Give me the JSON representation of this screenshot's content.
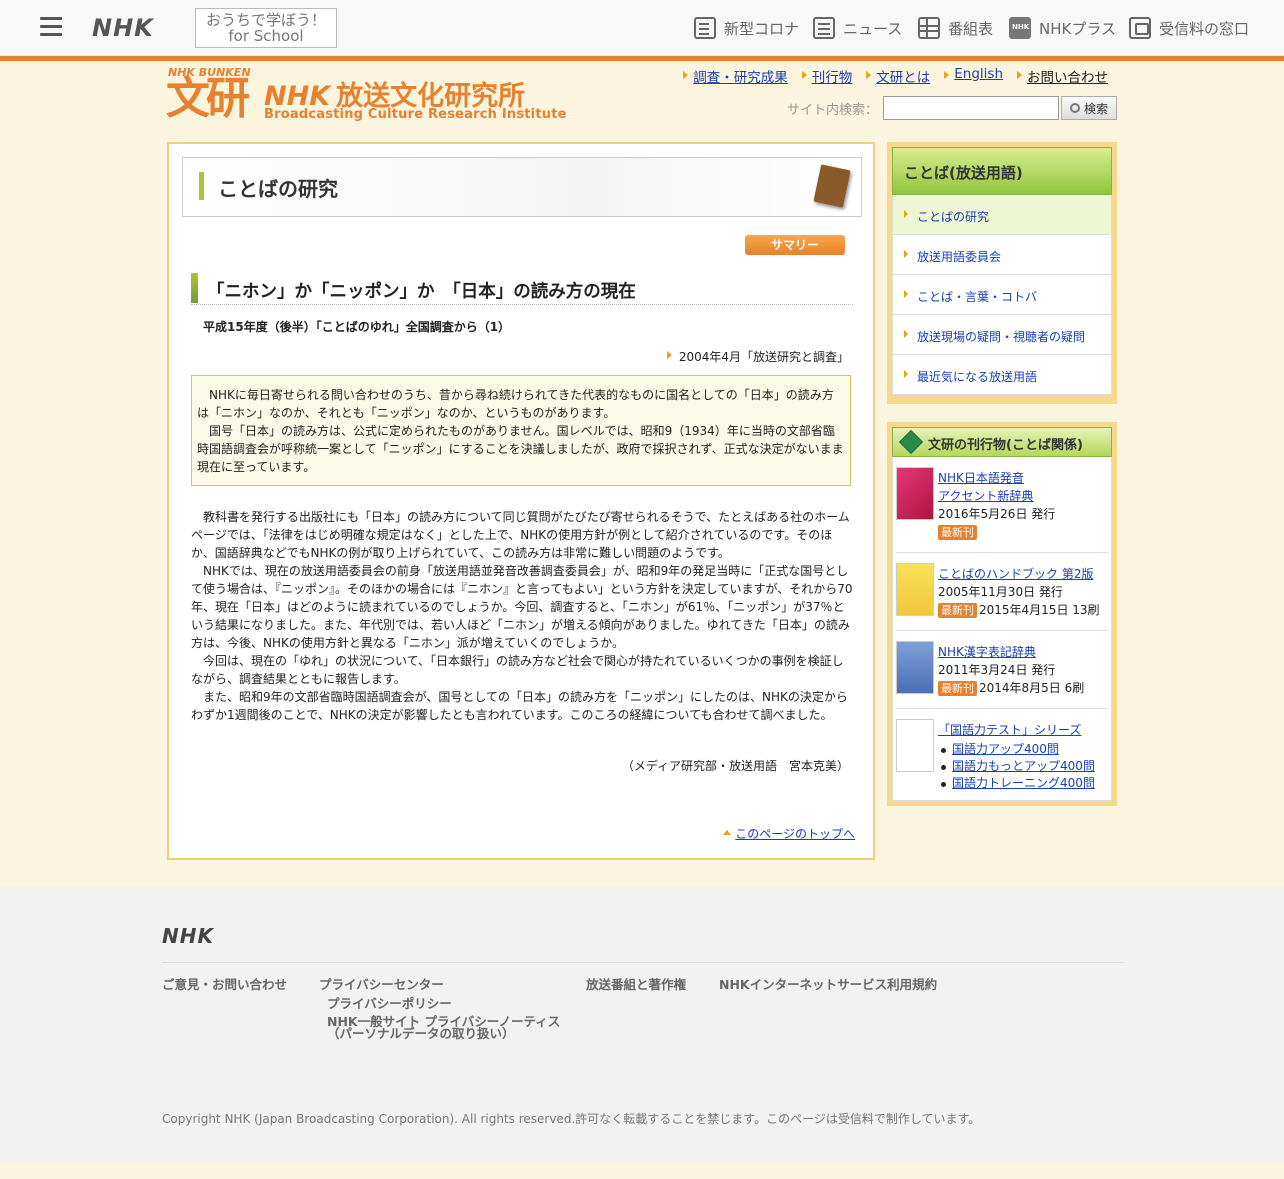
{
  "topbar": {
    "logo": "NHK",
    "school_line1": "おうちで学ぼう！",
    "school_line2": "for School",
    "nav": [
      {
        "label": "新型コロナ",
        "icon": "corona-info-icon"
      },
      {
        "label": "ニュース",
        "icon": "news-icon"
      },
      {
        "label": "番組表",
        "icon": "program-guide-icon"
      },
      {
        "label": "NHKプラス",
        "icon": "nhk-plus-icon"
      },
      {
        "label": "受信料の窓口",
        "icon": "fee-icon"
      }
    ]
  },
  "header": {
    "logo_small": "NHK BUNKEN",
    "logo_kanji": "文研",
    "logo_nhk": "NHK",
    "logo_title": "放送文化研究所",
    "logo_sub": "Broadcasting Culture Research Institute",
    "links": [
      "調査・研究成果",
      "刊行物",
      "文研とは",
      "English",
      "お問い合わせ"
    ],
    "search_label": "サイト内検索：",
    "search_value": "",
    "search_button": "検索"
  },
  "main": {
    "page_title": "ことばの研究",
    "summary_badge": "サマリー",
    "article_title": "「ニホン」か「ニッポン」か　「日本」の読み方の現在",
    "subtitle": "平成15年度（後半）「ことばのゆれ」全国調査から（1）",
    "pubinfo": "2004年4月「放送研究と調査」",
    "summary": [
      "NHKに毎日寄せられる問い合わせのうち、昔から尋ね続けられてきた代表的なものに国名としての「日本」の読み方は「ニホン」なのか、それとも「ニッポン」なのか、というものがあります。",
      "国号「日本」の読み方は、公式に定められたものがありません。国レベルでは、昭和9（1934）年に当時の文部省臨時国語調査会が呼称統一案として「ニッポン」にすることを決議しましたが、政府で採択されず、正式な決定がないまま現在に至っています。"
    ],
    "body": [
      "教科書を発行する出版社にも「日本」の読み方について同じ質問がたびたび寄せられるそうで、たとえばある社のホームページでは、「法律をはじめ明確な規定はなく」とした上で、NHKの使用方針が例として紹介されているのです。そのほか、国語辞典などでもNHKの例が取り上げられていて、この読み方は非常に難しい問題のようです。",
      "NHKでは、現在の放送用語委員会の前身「放送用語並発音改善調査委員会」が、昭和9年の発足当時に「正式な国号として使う場合は、『ニッポン』。そのほかの場合には『ニホン』と言ってもよい」という方針を決定していますが、それから70年、現在「日本」はどのように読まれているのでしょうか。今回、調査すると、「ニホン」が61％、「ニッポン」が37％という結果になりました。また、年代別では、若い人ほど「ニホン」が増える傾向がありました。ゆれてきた「日本」の読み方は、今後、NHKの使用方針と異なる「ニホン」派が増えていくのでしょうか。",
      "今回は、現在の「ゆれ」の状況について、「日本銀行」の読み方など社会で関心が持たれているいくつかの事例を検証しながら、調査結果とともに報告します。",
      "また、昭和9年の文部省臨時国語調査会が、国号としての「日本」の読み方を「ニッポン」にしたのは、NHKの決定からわずか1週間後のことで、NHKの決定が影響したとも言われています。このころの経緯についても合わせて調べました。"
    ],
    "author": "（メディア研究部・放送用語　宮本克美）",
    "pagetop": "このページのトップへ"
  },
  "sidebar": {
    "nav_title": "ことば(放送用語)",
    "nav_items": [
      "ことばの研究",
      "放送用語委員会",
      "ことば・言葉・コトバ",
      "放送現場の疑問・視聴者の疑問",
      "最近気になる放送用語"
    ],
    "pubs_title": "文研の刊行物(ことば関係)",
    "pubs": [
      {
        "title_line1": "NHK日本語発音",
        "title_line2": "アクセント新辞典",
        "date": "2016年5月26日 発行",
        "badge": "最新刊",
        "extra": ""
      },
      {
        "title_line1": "ことばのハンドブック 第2版",
        "title_line2": "",
        "date": "2005年11月30日 発行",
        "badge": "最新刊",
        "extra": "2015年4月15日 13刷"
      },
      {
        "title_line1": "NHK漢字表記辞典",
        "title_line2": "",
        "date": "2011年3月24日 発行",
        "badge": "最新刊",
        "extra": "2014年8月5日 6刷"
      },
      {
        "title_line1": "「国語力テスト」シリーズ",
        "title_line2": "",
        "date": "",
        "badge": "",
        "extra": "",
        "items": [
          "国語力アップ400問",
          "国語力もっとアップ400問",
          "国語力トレーニング400問"
        ]
      }
    ],
    "colors": {
      "accent": "#e8812e",
      "green": "#8ec53f",
      "frame": "#f6d98c"
    }
  },
  "footer": {
    "logo": "NHK",
    "links": [
      "ご意見・お問い合わせ",
      "プライバシーセンター",
      "放送番組と著作権",
      "NHKインターネットサービス利用規約"
    ],
    "privacy_sub1": "プライバシーポリシー",
    "privacy_sub2_line1": "NHK一般サイト プライバシーノーティス",
    "privacy_sub2_line2": "（パーソナルデータの取り扱い）",
    "copyright": "Copyright NHK (Japan Broadcasting Corporation). All rights reserved.許可なく転載することを禁じます。このページは受信料で制作しています。"
  }
}
